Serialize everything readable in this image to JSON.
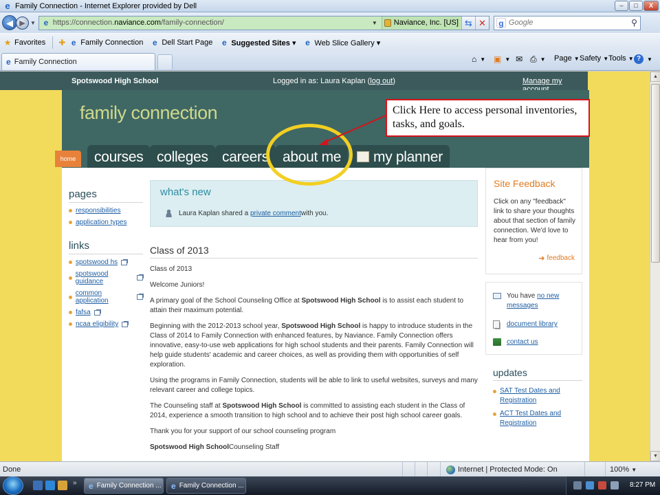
{
  "window": {
    "title": "Family Connection - Internet Explorer provided by Dell",
    "controls": {
      "minimize": "–",
      "maximize": "□",
      "close": "X"
    }
  },
  "address": {
    "url_prefix": "https://connection.",
    "url_host": "naviance.com",
    "url_path": "/family-connection/",
    "cert_label": "Naviance, Inc. [US]",
    "search_placeholder": "Google"
  },
  "favorites": {
    "label": "Favorites",
    "items": [
      {
        "label": "Family Connection"
      },
      {
        "label": "Dell Start Page"
      },
      {
        "label": "Suggested Sites ▾"
      },
      {
        "label": "Web Slice Gallery ▾"
      }
    ]
  },
  "tab": {
    "label": "Family Connection"
  },
  "commands": {
    "page": "Page",
    "safety": "Safety",
    "tools": "Tools",
    "help": "?"
  },
  "site": {
    "school": "Spotswood High School",
    "logged_prefix": "Logged in as: Laura Kaplan (",
    "logout": "log out",
    "logged_suffix": ")",
    "manage_account": "Manage my account",
    "brand": "family connection",
    "home": "home",
    "nav": [
      "courses",
      "colleges",
      "careers",
      "about me",
      "my planner"
    ]
  },
  "sidebar": {
    "pages_title": "pages",
    "pages": [
      "responsibilities",
      "application types"
    ],
    "links_title": "links",
    "links": [
      "spotswood hs",
      "spotswood guidance",
      "common application",
      "fafsa",
      "ncaa eligibility"
    ]
  },
  "whatsnew": {
    "title": "what's new",
    "msg_prefix": "Laura Kaplan shared a ",
    "msg_link": "private comment",
    "msg_suffix": " with you."
  },
  "article": {
    "title": "Class of 2013",
    "p1": "Class of 2013",
    "p2": "Welcome Juniors!",
    "p3a": "A primary goal of the School Counseling Office at ",
    "p3b": "Spotswood High School",
    "p3c": " is to assist each student to attain their maximum potential.",
    "p4a": "Beginning with the 2012-2013 school year, ",
    "p4b": "Spotswood High School",
    "p4c": " is happy to introduce students in the Class of 2014 to Family Connection with enhanced features, by Naviance. Family Connection offers innovative, easy-to-use web applications for high school students and their parents. Family Connection will help guide students' academic and career choices, as well as providing them with opportunities of self exploration.",
    "p5": "Using the programs in Family Connection, students will be able to link to useful websites, surveys and many relevant career and college topics.",
    "p6a": "The Counseling staff at ",
    "p6b": "Spotswood High School",
    "p6c": " is committed to assisting each student in the Class of 2014, experience a smooth transition to high school and to achieve their post high school career goals.",
    "p7": "Thank you for your support of our school counseling program",
    "p8a": "Spotswood High School",
    "p8b": "Counseling Staff"
  },
  "feedback": {
    "title": "Site Feedback",
    "body": "Click on any \"feedback\" link to share your thoughts about that section of family connection. We'd love to hear from you!",
    "link": "feedback"
  },
  "tools": {
    "messages_prefix": "You have ",
    "messages_link": "no new messages",
    "documents": "document library",
    "contact": "contact us"
  },
  "updates": {
    "title": "updates",
    "items": [
      "SAT Test Dates and Registration",
      "ACT Test Dates and Registration"
    ]
  },
  "annotation": {
    "text": "Click Here to access personal inventories, tasks, and goals."
  },
  "status": {
    "left": "Done",
    "zone": "Internet | Protected Mode: On",
    "zoom": "100%"
  },
  "taskbar": {
    "buttons": [
      "Family Connection ...",
      "Family Connection ..."
    ],
    "clock": "8:27 PM"
  },
  "colors": {
    "page_background": "#f2db5b",
    "header": "#3f6764",
    "brand_text": "#cfd98a",
    "accent_orange": "#e07b22",
    "annotation_red": "#d4141b",
    "highlight_yellow": "#f2cf23"
  }
}
